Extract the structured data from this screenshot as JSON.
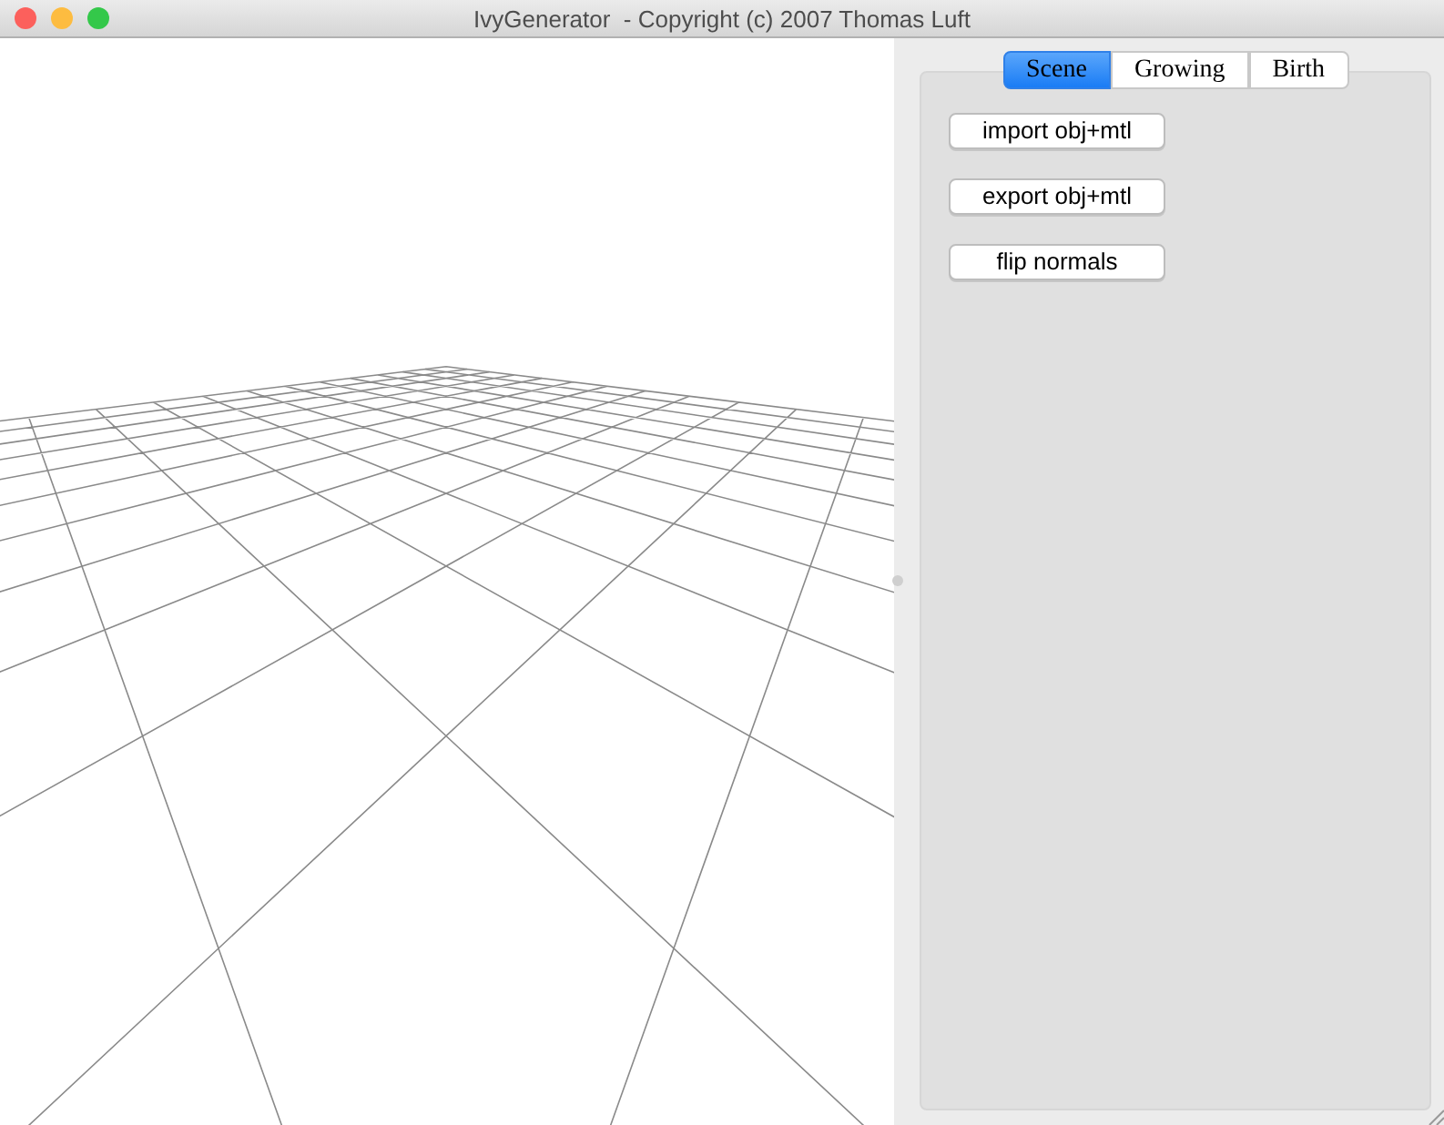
{
  "window": {
    "title": "IvyGenerator  - Copyright (c) 2007 Thomas Luft"
  },
  "panel": {
    "tabs": [
      {
        "label": "Scene",
        "selected": true
      },
      {
        "label": "Growing",
        "selected": false
      },
      {
        "label": "Birth",
        "selected": false
      }
    ],
    "buttons": [
      "import obj+mtl",
      "export obj+mtl",
      "flip normals"
    ]
  }
}
